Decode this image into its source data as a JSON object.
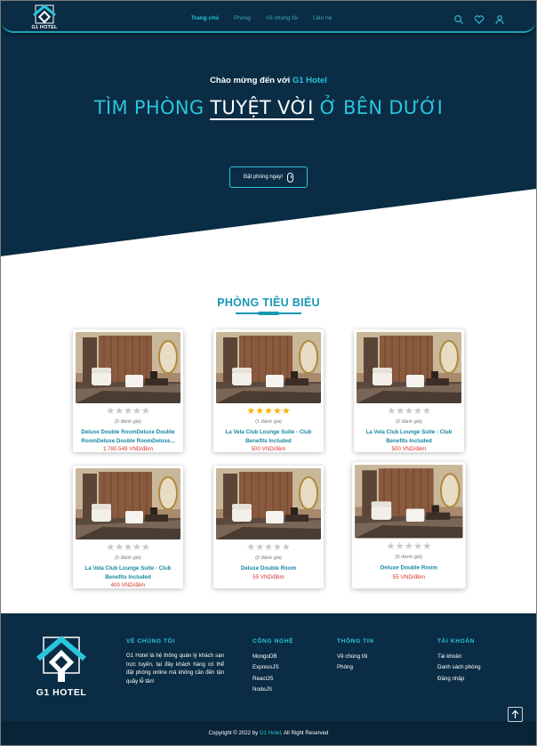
{
  "header": {
    "logo_text": "G1 HOTEL",
    "nav": [
      {
        "label": "Trang chủ",
        "active": true
      },
      {
        "label": "Phòng",
        "active": false
      },
      {
        "label": "Về chúng tôi",
        "active": false
      },
      {
        "label": "Liên hệ",
        "active": false
      }
    ],
    "icons": [
      "search-icon",
      "heart-icon",
      "user-icon"
    ]
  },
  "hero": {
    "welcome_prefix": "Chào mừng đến với ",
    "welcome_brand": "G1 Hotel",
    "headline_before": "TÌM PHÒNG ",
    "headline_highlight": "TUYỆT VỜI",
    "headline_after": " Ở BÊN DƯỚI",
    "cta_label": "Đặt phòng ngay!"
  },
  "featured": {
    "title": "PHÒNG TIÊU BIỂU",
    "rooms": [
      {
        "name": "Deluxe Double RoomDeluxe Double RoomDeluxe Double RoomDeluxe...",
        "rating": 0,
        "reviews": "(0 đánh giá)",
        "price": "1.780.549 VND/đêm"
      },
      {
        "name": "La Vela Club Lounge Suite - Club Benefits Included",
        "rating": 5,
        "reviews": "(1 đánh giá)",
        "price": "500 VND/đêm"
      },
      {
        "name": "La Vela Club Lounge Suite - Club Benefits Included",
        "rating": 0,
        "reviews": "(0 đánh giá)",
        "price": "500 VND/đêm"
      },
      {
        "name": "La Vela Club Lounge Suite - Club Benefits Included",
        "rating": 0,
        "reviews": "(0 đánh giá)",
        "price": "400 VND/đêm"
      },
      {
        "name": "Deluxe Double Room",
        "rating": 0,
        "reviews": "(0 đánh giá)",
        "price": "55 VND/đêm"
      },
      {
        "name": "Deluxe Double Room",
        "rating": 0,
        "reviews": "(0 đánh giá)",
        "price": "55 VND/đêm"
      }
    ]
  },
  "footer": {
    "logo_text": "G1 HOTEL",
    "about_title": "VỀ CHÚNG TÔI",
    "about_text": "G1 Hotel là hệ thống quản lý khách sạn trực tuyến, tại đây khách hàng có thể đặt phòng online mà không cần đến tận quầy lễ tân!",
    "tech_title": "CÔNG NGHỆ",
    "tech": [
      "MongoDB",
      "ExpressJS",
      "ReactJS",
      "NodeJS"
    ],
    "info_title": "THÔNG TIN",
    "info": [
      "Về chúng tôi",
      "Phòng"
    ],
    "account_title": "TÀI KHOẢN",
    "account": [
      "Tài khoản",
      "Danh sách phòng",
      "Đăng nhập"
    ],
    "copyright_prefix": "Copyright © 2022 by ",
    "copyright_brand": "G1 Hotel",
    "copyright_suffix": ". All Right Reserved"
  },
  "colors": {
    "navy": "#0a2c44",
    "accent": "#2ac5dc",
    "price": "#d9342b",
    "star": "#f4b400"
  }
}
